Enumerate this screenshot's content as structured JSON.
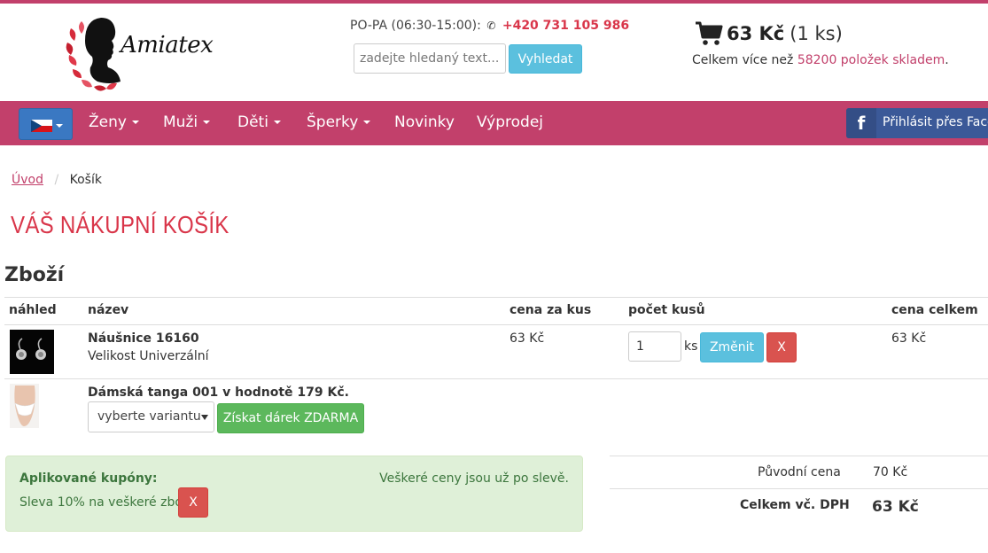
{
  "header": {
    "logo_text": "Amiatex",
    "hours_label": "PO-PA (06:30-15:00):",
    "phone": "+420 731 105 986",
    "search": {
      "placeholder": "zadejte hledaný text...",
      "button_label": "Vyhledat"
    },
    "cart": {
      "total": "63 Kč",
      "count": "(1 ks)"
    },
    "stock": {
      "prefix": "Celkem více než",
      "count": "58200 položek skladem",
      "suffix": "."
    }
  },
  "nav": {
    "language": "cs",
    "items": [
      {
        "label": "Ženy",
        "dropdown": true
      },
      {
        "label": "Muži",
        "dropdown": true
      },
      {
        "label": "Děti",
        "dropdown": true
      },
      {
        "label": "Šperky",
        "dropdown": true
      },
      {
        "label": "Novinky",
        "dropdown": false
      },
      {
        "label": "Výprodej",
        "dropdown": false
      }
    ],
    "facebook_login": "Přihlásit přes Facebook"
  },
  "breadcrumb": {
    "home": "Úvod",
    "current": "Košík"
  },
  "page_title": "VÁŠ NÁKUPNÍ KOŠÍK",
  "section_title": "Zboží",
  "table": {
    "headers": {
      "preview": "náhled",
      "name": "název",
      "unit_price": "cena za kus",
      "quantity": "počet kusů",
      "total": "cena celkem"
    },
    "items": [
      {
        "name": "Náušnice 16160",
        "variant": "Velikost Univerzální",
        "unit_price": "63 Kč",
        "quantity": "1",
        "quantity_unit": "ks",
        "change_label": "Změnit",
        "remove_label": "X",
        "total": "63 Kč"
      }
    ],
    "gift": {
      "title": "Dámská tanga 001 v hodnotě 179 Kč.",
      "select_value": "vyberte variantu",
      "button_label": "Získat dárek ZDARMA"
    }
  },
  "coupons": {
    "title": "Aplikované kupóny:",
    "item": "Sleva 10% na veškeré zboží",
    "remove_label": "X",
    "note": "Veškeré ceny jsou už po slevě."
  },
  "totals": {
    "original_label": "Původní cena",
    "original_value": "70 Kč",
    "total_label": "Celkem vč. DPH",
    "total_value": "63 Kč"
  },
  "colors": {
    "brand": "#c2406b",
    "accent_red": "#d9364a",
    "info": "#5bc0de",
    "success": "#5cb85c",
    "danger": "#d9534f"
  }
}
